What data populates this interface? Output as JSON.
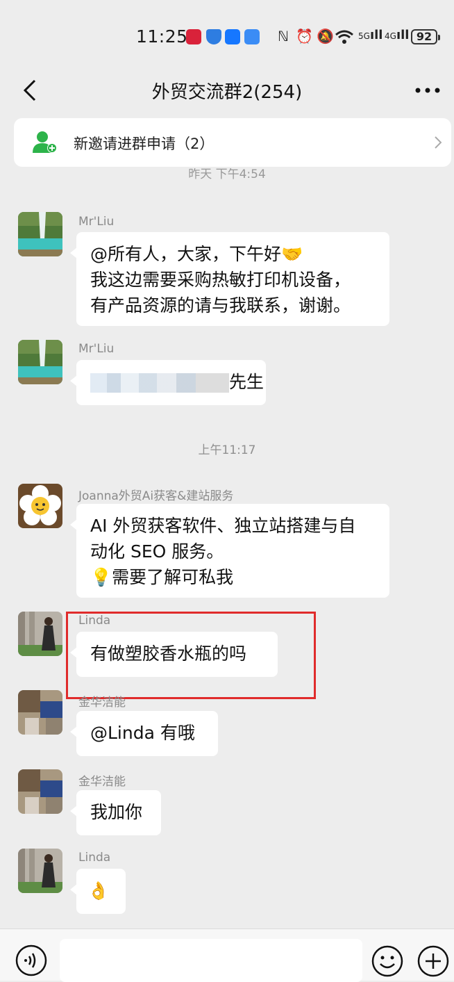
{
  "status_bar": {
    "time": "11:25",
    "network_5g": "5G",
    "network_4g": "4G",
    "battery": "92"
  },
  "header": {
    "title": "外贸交流群2(254)"
  },
  "banner": {
    "text": "新邀请进群申请（2）"
  },
  "timestamps": {
    "partial_top": "昨天 下午4:54",
    "morning": "上午11:17"
  },
  "messages": [
    {
      "sender": "Mr'Liu",
      "lines": [
        "@所有人，大家，下午好🤝",
        "我这边需要采购热敏打印机设备，",
        "有产品资源的请与我联系，谢谢。"
      ]
    },
    {
      "sender": "Mr'Liu",
      "suffix": "先生"
    },
    {
      "sender": "Joanna外贸Ai获客&建站服务",
      "lines": [
        "AI 外贸获客软件、独立站搭建与自",
        "动化 SEO 服务。",
        "💡需要了解可私我"
      ]
    },
    {
      "sender": "Linda",
      "text": "有做塑胶香水瓶的吗"
    },
    {
      "sender": "金华洁能",
      "text": "@Linda  有哦"
    },
    {
      "sender": "金华洁能",
      "text": "我加你"
    },
    {
      "sender": "Linda",
      "text": "👌"
    }
  ],
  "input": {
    "placeholder": ""
  },
  "colors": {
    "background": "#ededed",
    "bubble": "#ffffff",
    "highlight": "#e02b2b",
    "invite_icon": "#2db34a"
  }
}
